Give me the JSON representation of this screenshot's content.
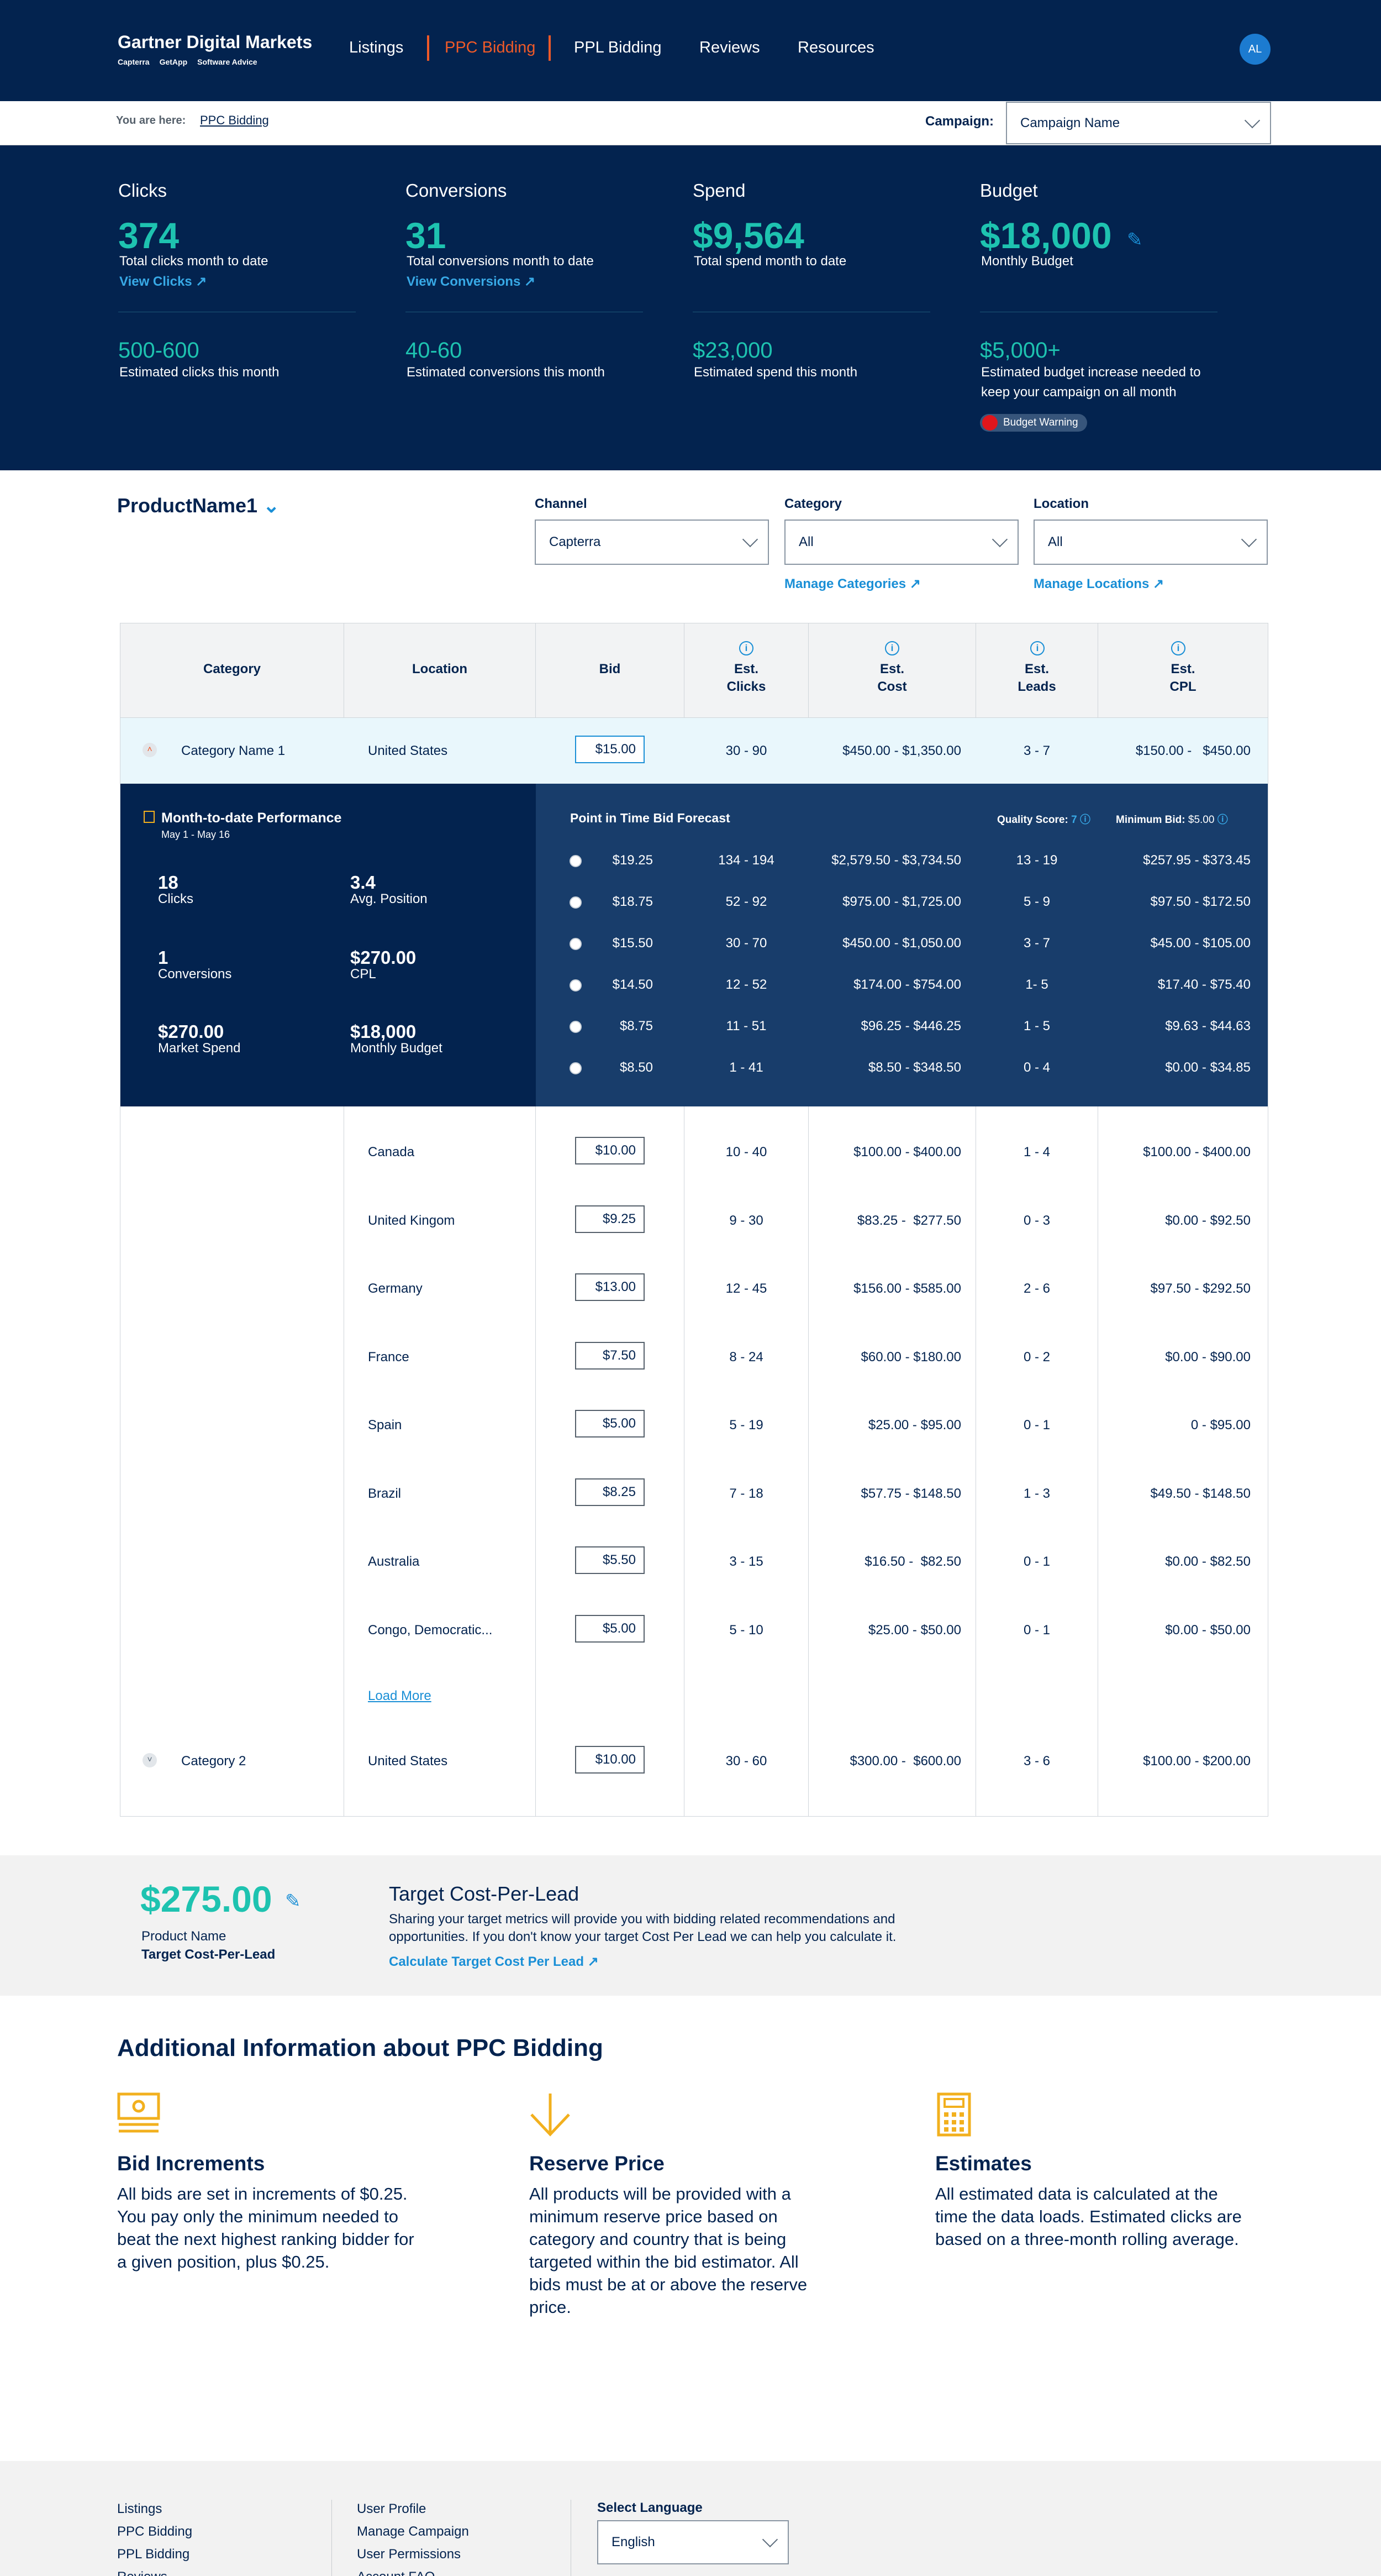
{
  "header": {
    "logo_title": "Gartner Digital Markets",
    "brands": [
      "Capterra",
      "GetApp",
      "Software Advice"
    ],
    "nav": [
      "Listings",
      "PPC Bidding",
      "PPL Bidding",
      "Reviews",
      "Resources"
    ],
    "avatar": "AL"
  },
  "breadcrumb": {
    "label": "You are here:",
    "link": "PPC Bidding",
    "campaign_label": "Campaign:",
    "campaign_value": "Campaign Name"
  },
  "kpis": [
    {
      "title": "Clicks",
      "value": "374",
      "sub": "Total clicks month to date",
      "link": "View Clicks",
      "est": "500-600",
      "est_sub": "Estimated clicks this month"
    },
    {
      "title": "Conversions",
      "value": "31",
      "sub": "Total conversions month to date",
      "link": "View Conversions",
      "est": "40-60",
      "est_sub": "Estimated conversions this month"
    },
    {
      "title": "Spend",
      "value": "$9,564",
      "sub": "Total spend month to date",
      "est": "$23,000",
      "est_sub": "Estimated spend this month"
    },
    {
      "title": "Budget",
      "value": "$18,000",
      "sub": "Monthly Budget",
      "est": "$5,000+",
      "est_sub": "Estimated budget increase needed to",
      "est_sub2": "keep your campaign on all month",
      "warning": "Budget Warning"
    }
  ],
  "filters": {
    "product": "ProductName1",
    "channel_label": "Channel",
    "channel": "Capterra",
    "category_label": "Category",
    "category": "All",
    "category_link": "Manage Categories",
    "location_label": "Location",
    "location": "All",
    "location_link": "Manage Locations"
  },
  "table": {
    "headers": {
      "category": "Category",
      "location": "Location",
      "bid": "Bid",
      "clicks1": "Est.",
      "clicks2": "Clicks",
      "cost1": "Est.",
      "cost2": "Cost",
      "leads1": "Est.",
      "leads2": "Leads",
      "cpl1": "Est.",
      "cpl2": "CPL"
    },
    "row1": {
      "category": "Category Name 1",
      "location": "United States",
      "bid": "$15.00",
      "clicks": "30 - 90",
      "cost": "$450.00 - $1,350.00",
      "leads": "3 - 7",
      "cpl": "$150.00 -   $450.00"
    },
    "perf": {
      "title": "Month-to-date Performance",
      "dates": "May 1 - May 16",
      "stats": [
        {
          "v": "18",
          "l": "Clicks"
        },
        {
          "v": "3.4",
          "l": "Avg. Position"
        },
        {
          "v": "1",
          "l": "Conversions"
        },
        {
          "v": "$270.00",
          "l": "CPL"
        },
        {
          "v": "$270.00",
          "l": "Market Spend"
        },
        {
          "v": "$18,000",
          "l": "Monthly Budget"
        }
      ]
    },
    "forecast": {
      "title": "Point in Time Bid Forecast",
      "quality_label": "Quality Score:",
      "quality": "7",
      "min_label": "Minimum Bid:",
      "min": "$5.00",
      "rows": [
        {
          "bid": "$19.25",
          "clicks": "134 - 194",
          "cost": "$2,579.50 - $3,734.50",
          "leads": "13 - 19",
          "cpl": "$257.95 - $373.45"
        },
        {
          "bid": "$18.75",
          "clicks": "52 - 92",
          "cost": "$975.00 - $1,725.00",
          "leads": "5 - 9",
          "cpl": "$97.50 - $172.50"
        },
        {
          "bid": "$15.50",
          "clicks": "30 - 70",
          "cost": "$450.00 - $1,050.00",
          "leads": "3 - 7",
          "cpl": "$45.00 - $105.00"
        },
        {
          "bid": "$14.50",
          "clicks": "12 - 52",
          "cost": "$174.00 - $754.00",
          "leads": "1- 5",
          "cpl": "$17.40 - $75.40"
        },
        {
          "bid": "$8.75",
          "clicks": "11 - 51",
          "cost": "$96.25 - $446.25",
          "leads": "1 - 5",
          "cpl": "$9.63 - $44.63"
        },
        {
          "bid": "$8.50",
          "clicks": "1 - 41",
          "cost": "$8.50 - $348.50",
          "leads": "0 - 4",
          "cpl": "$0.00 - $34.85"
        }
      ]
    },
    "locations": [
      {
        "location": "Canada",
        "bid": "$10.00",
        "clicks": "10 - 40",
        "cost": "$100.00 - $400.00",
        "leads": "1 - 4",
        "cpl": "$100.00 - $400.00"
      },
      {
        "location": "United Kingom",
        "bid": "$9.25",
        "clicks": "9 - 30",
        "cost": "$83.25 -  $277.50",
        "leads": "0 - 3",
        "cpl": "$0.00 - $92.50"
      },
      {
        "location": "Germany",
        "bid": "$13.00",
        "clicks": "12 - 45",
        "cost": "$156.00 - $585.00",
        "leads": "2 - 6",
        "cpl": "$97.50 - $292.50"
      },
      {
        "location": "France",
        "bid": "$7.50",
        "clicks": "8 - 24",
        "cost": "$60.00 - $180.00",
        "leads": "0 - 2",
        "cpl": "$0.00 - $90.00"
      },
      {
        "location": "Spain",
        "bid": "$5.00",
        "clicks": "5 - 19",
        "cost": "$25.00 - $95.00",
        "leads": "0 - 1",
        "cpl": "0 - $95.00"
      },
      {
        "location": "Brazil",
        "bid": "$8.25",
        "clicks": "7 - 18",
        "cost": "$57.75 - $148.50",
        "leads": "1 - 3",
        "cpl": "$49.50 - $148.50"
      },
      {
        "location": "Australia",
        "bid": "$5.50",
        "clicks": "3 - 15",
        "cost": "$16.50 -  $82.50",
        "leads": "0 - 1",
        "cpl": "$0.00 - $82.50"
      },
      {
        "location": "Congo, Democratic...",
        "bid": "$5.00",
        "clicks": "5 - 10",
        "cost": "$25.00 - $50.00",
        "leads": "0 - 1",
        "cpl": "$0.00 - $50.00"
      }
    ],
    "load_more": "Load More",
    "row2": {
      "category": "Category 2",
      "location": "United States",
      "bid": "$10.00",
      "clicks": "30 - 60",
      "cost": "$300.00 -  $600.00",
      "leads": "3 - 6",
      "cpl": "$100.00 - $200.00"
    }
  },
  "target": {
    "value": "$275.00",
    "product": "Product Name",
    "label": "Target Cost-Per-Lead",
    "title": "Target Cost-Per-Lead",
    "desc1": "Sharing your target metrics will provide you with bidding related recommendations and",
    "desc2": "opportunities. If you don't know your target Cost Per Lead we can help you calculate it.",
    "link": "Calculate Target Cost Per Lead"
  },
  "additional": {
    "title": "Additional Information about PPC Bidding",
    "items": [
      {
        "icon": "money-icon",
        "title": "Bid Increments",
        "lines": [
          "All bids are set in increments of $0.25.",
          "You pay only the minimum needed to",
          "beat the next highest ranking bidder for",
          "a given position, plus $0.25."
        ]
      },
      {
        "icon": "arrow-down-icon",
        "title": "Reserve Price",
        "lines": [
          "All products will be provided with a",
          "minimum reserve price based on",
          "category and country that is being",
          "targeted within the bid estimator. All",
          "bids must be at or above the reserve",
          "price."
        ]
      },
      {
        "icon": "calculator-icon",
        "title": "Estimates",
        "lines": [
          "All estimated data is calculated at the",
          "time the data loads. Estimated clicks are",
          "based on a three-month rolling average."
        ]
      }
    ]
  },
  "footer": {
    "col1": [
      "Listings",
      "PPC Bidding",
      "PPL Bidding",
      "Reviews"
    ],
    "col2": [
      "User Profile",
      "Manage Campaign",
      "User Permissions",
      "Account FAQ"
    ],
    "lang_label": "Select Language",
    "lang": "English"
  },
  "colors": {
    "navy": "#03234f",
    "teal": "#1ec3b0",
    "orange": "#f05a28",
    "link": "#1a8fd6",
    "yellow": "#f2b01e"
  }
}
